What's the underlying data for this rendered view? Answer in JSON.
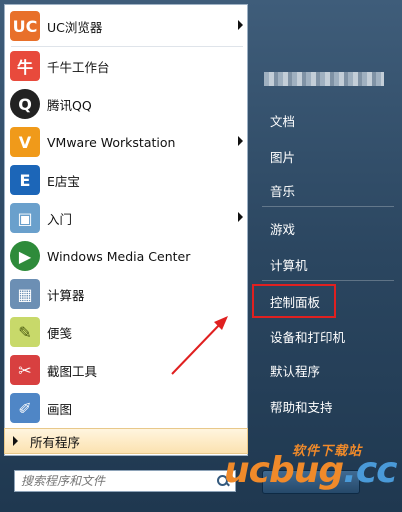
{
  "programs": [
    {
      "label": "UC浏览器",
      "icon": "uc-browser-icon",
      "color": "#e8702a",
      "glyph": "UC",
      "has_submenu": true
    },
    {
      "label": "千牛工作台",
      "icon": "qianniu-icon",
      "color": "#e84a3c",
      "glyph": "牛",
      "has_submenu": false
    },
    {
      "label": "腾讯QQ",
      "icon": "qq-penguin-icon",
      "color": "#222222",
      "glyph": "Q",
      "has_submenu": false
    },
    {
      "label": "VMware Workstation",
      "icon": "vmware-icon",
      "color": "#f09a1a",
      "glyph": "V",
      "has_submenu": true
    },
    {
      "label": "E店宝",
      "icon": "edianbao-icon",
      "color": "#1c66b8",
      "glyph": "E",
      "has_submenu": false
    },
    {
      "label": "入门",
      "icon": "getting-started-icon",
      "color": "#6aa0cc",
      "glyph": "▣",
      "has_submenu": true
    },
    {
      "label": "Windows Media Center",
      "icon": "media-center-icon",
      "color": "#2e8b3a",
      "glyph": "▶",
      "has_submenu": false
    },
    {
      "label": "计算器",
      "icon": "calculator-icon",
      "color": "#6c8fb4",
      "glyph": "▦",
      "has_submenu": false
    },
    {
      "label": "便笺",
      "icon": "sticky-notes-icon",
      "color": "#c8d96a",
      "glyph": "✎",
      "has_submenu": false
    },
    {
      "label": "截图工具",
      "icon": "snipping-tool-icon",
      "color": "#d84040",
      "glyph": "✂",
      "has_submenu": false
    },
    {
      "label": "画图",
      "icon": "paint-icon",
      "color": "#4f86c6",
      "glyph": "✐",
      "has_submenu": false
    }
  ],
  "all_programs_label": "所有程序",
  "search": {
    "placeholder": "搜索程序和文件"
  },
  "right_menu": [
    {
      "label": "文档"
    },
    {
      "label": "图片"
    },
    {
      "label": "音乐"
    },
    {
      "label": "游戏"
    },
    {
      "label": "计算机"
    },
    {
      "label": "控制面板"
    },
    {
      "label": "设备和打印机"
    },
    {
      "label": "默认程序"
    },
    {
      "label": "帮助和支持"
    }
  ],
  "watermark": {
    "small": "软件下载站",
    "big": "ucbug",
    "suffix": ".cc"
  },
  "colors": {
    "highlight_box": "#e02020",
    "arrow": "#e02020",
    "watermark_orange": "#f08a2a",
    "watermark_blue": "#4a9ad8"
  }
}
